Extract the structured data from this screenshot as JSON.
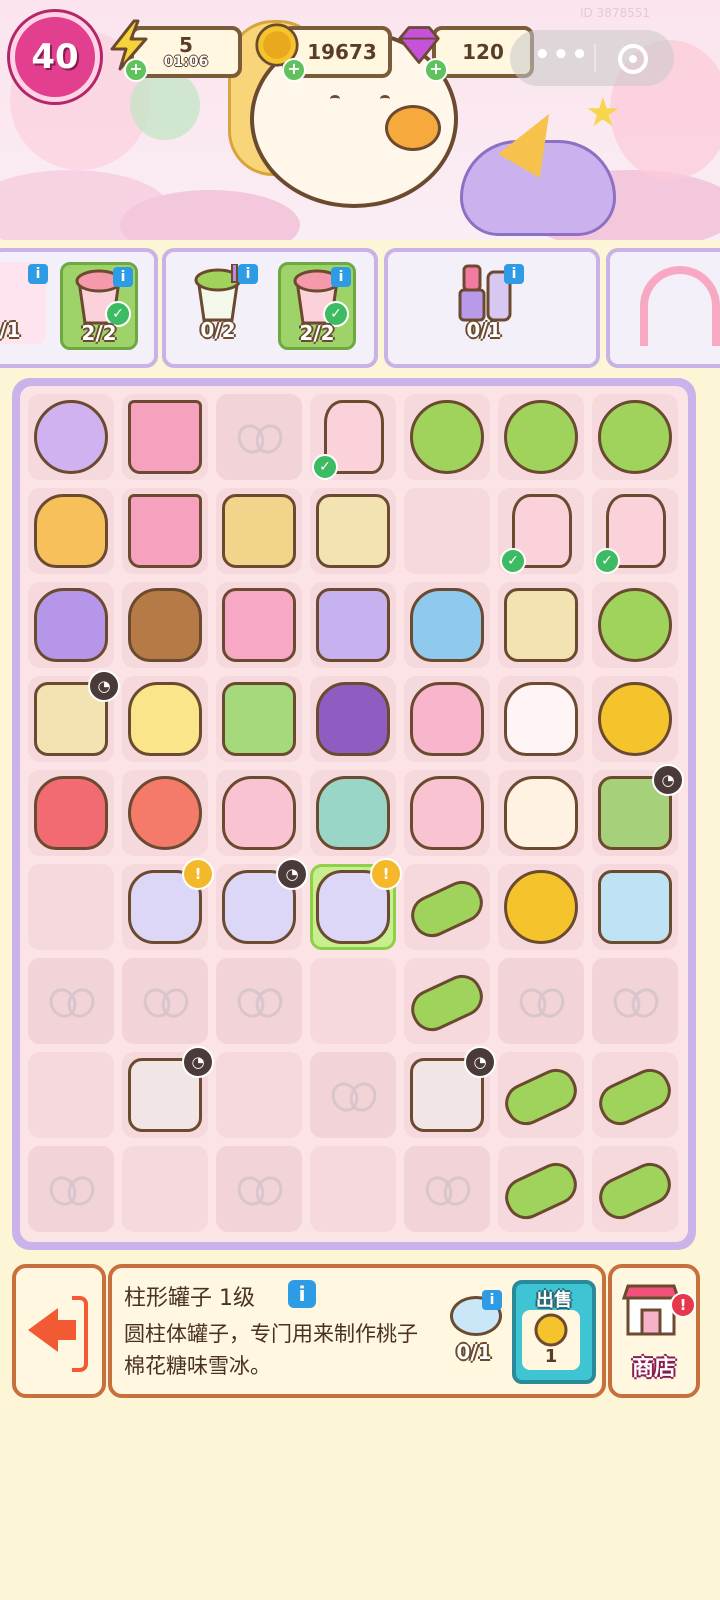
{
  "hud": {
    "level": "40",
    "energy": {
      "value": "5",
      "timer": "01:06",
      "icon": "lightning-icon"
    },
    "coins": {
      "value": "19673",
      "icon": "coin-icon"
    },
    "gems": {
      "value": "120",
      "icon": "gem-icon"
    },
    "more_label": "•••",
    "uid": "ID 3878551"
  },
  "orders": [
    {
      "items": [
        {
          "count": "/1"
        },
        {
          "count": "2/2",
          "done": true
        }
      ]
    },
    {
      "items": [
        {
          "count": "0/2"
        },
        {
          "count": "2/2",
          "done": true
        }
      ]
    },
    {
      "items": [
        {
          "count": "0/1"
        }
      ]
    },
    {
      "items": []
    }
  ],
  "board": {
    "cols": 7,
    "rows": 9,
    "cells": [
      [
        "ferris-wheel",
        "castle",
        "locked",
        "shake-check",
        "lollipop",
        "lollipop",
        "lollipop"
      ],
      [
        "carousel-cups",
        "castle",
        "cracker",
        "gift-box",
        "empty",
        "shake-check",
        "shake-check"
      ],
      [
        "dress",
        "teddy-bear",
        "compact",
        "compact-open",
        "cat-plush",
        "butter",
        "lollipop-small"
      ],
      [
        "gift-bag-timer",
        "generator-glow",
        "map",
        "skirt",
        "lint-roller",
        "unicorn-plush",
        "coins"
      ],
      [
        "carousel",
        "hamster",
        "mochi",
        "seal",
        "mochi",
        "puppy",
        "shop-timer"
      ],
      [
        "empty",
        "jar-alert",
        "jar-timer",
        "jar-alert-selected",
        "candy",
        "coin",
        "tickets"
      ],
      [
        "locked",
        "locked",
        "locked",
        "empty",
        "candy",
        "locked",
        "locked"
      ],
      [
        "empty",
        "cabinet-timer",
        "empty",
        "locked",
        "cabinet-timer",
        "candy",
        "candy"
      ],
      [
        "locked",
        "empty",
        "locked",
        "empty",
        "locked",
        "candy",
        "candy"
      ]
    ]
  },
  "selected_item": {
    "name": "柱形罐子 1级",
    "description": "圆柱体罐子，专门用来制作桃子棉花糖味雪冰。",
    "requirement_count": "0/1",
    "sell_label": "出售",
    "sell_price": "1"
  },
  "shop_label": "商店",
  "colors": {
    "accent": "#e23f8f",
    "board_border": "#c9b3ea",
    "panel_border": "#c86f3e",
    "sell": "#3fc4d4"
  }
}
